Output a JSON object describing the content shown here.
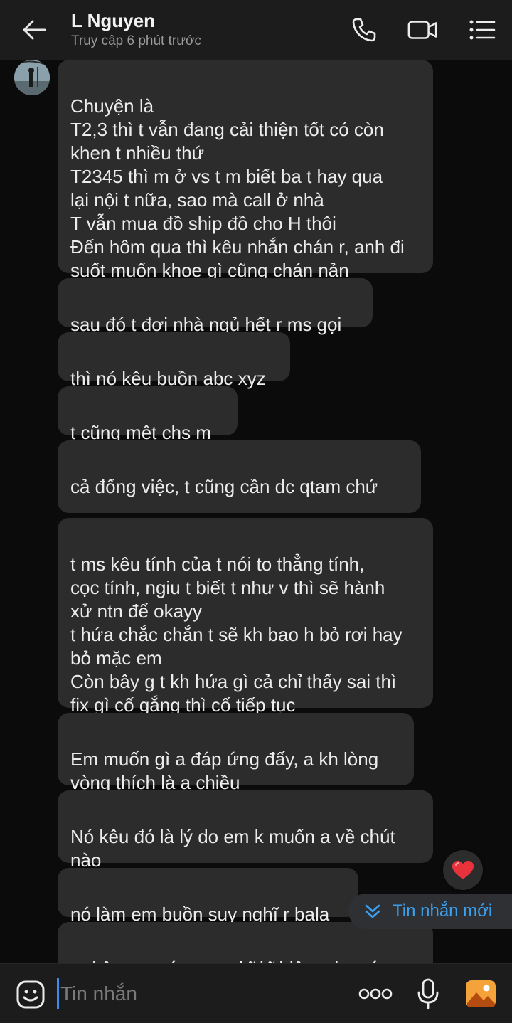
{
  "header": {
    "name": "L Nguyen",
    "status": "Truy cập 6 phút trước"
  },
  "messages": [
    {
      "text": "Chuyện là\nT2,3 thì t vẫn đang cải thiện tốt có còn\nkhen t nhiều thứ\nT2345 thì m ở vs t m biết ba t hay qua\nlại nội t nữa, sao mà call ở nhà\nT vẫn mua đồ ship đồ cho H thôi\nĐến hôm qua thì kêu nhắn chán r, anh đi\nsuốt muốn khoe gì cũng chán nản"
    },
    {
      "text": "sau đó t đợi nhà ngủ hết r ms gọi"
    },
    {
      "text": "thì nó kêu buồn abc xyz"
    },
    {
      "text": "t cũng mệt chs m"
    },
    {
      "text": "cả đống việc, t cũng cần dc qtam chứ"
    },
    {
      "text": "t ms kêu tính của t nói to thẳng tính,\ncọc tính, ngiu t biết t như v thì sẽ hành\nxử ntn để okayy\nt hứa chắc chắn t sẽ kh bao h bỏ rơi hay\nbỏ mặc em\nCòn bây g t kh hứa gì cả chỉ thấy sai thì\nfix gì cố gắng thì cố tiếp tục"
    },
    {
      "text": "Em muốn gì a đáp ứng đấy, a kh lòng\nvòng thích là a chiều"
    },
    {
      "text": "Nó kêu đó là lý do em k muốn a về chút\nnào"
    },
    {
      "text": "nó làm em buồn suy nghĩ r bala"
    },
    {
      "text": "r t kêu em cứ suy nghĩ kĩ hiện tại a có\nthể lỡ ...."
    }
  ],
  "new_message_pill": {
    "label": "Tin nhắn mới"
  },
  "reaction": {
    "icon": "heart-icon",
    "color": "#e8323c"
  },
  "composer": {
    "placeholder": "Tin nhắn"
  },
  "colors": {
    "accent": "#3a8ef0",
    "bubble": "#2c2c2d",
    "header": "#1c1c1c"
  }
}
